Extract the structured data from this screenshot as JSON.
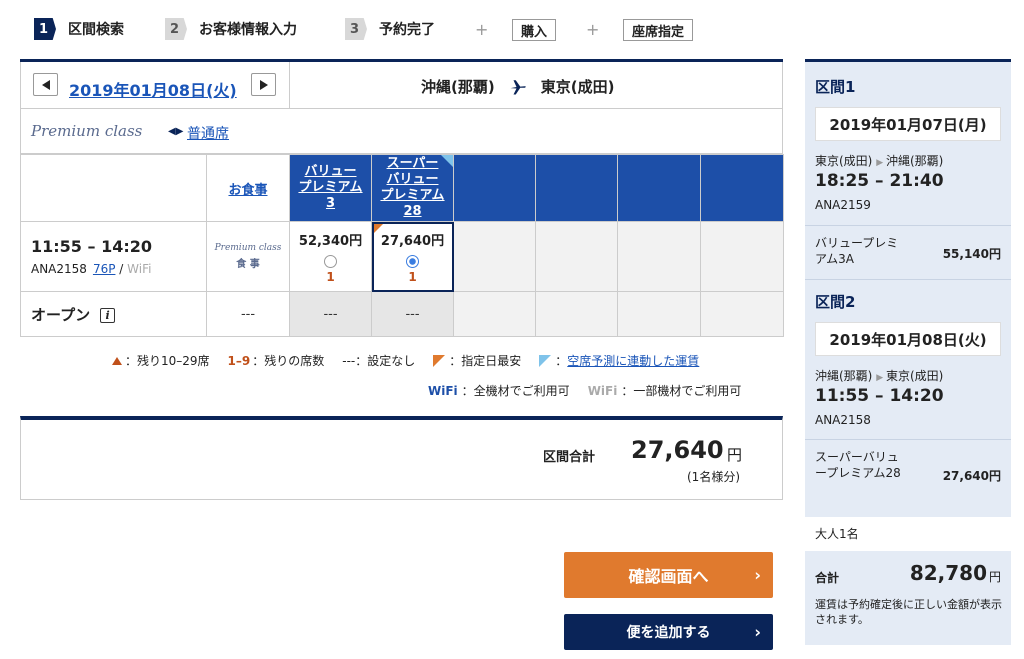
{
  "steps": {
    "items": [
      {
        "num": "1",
        "label": "区間検索"
      },
      {
        "num": "2",
        "label": "お客様情報入力"
      },
      {
        "num": "3",
        "label": "予約完了"
      }
    ],
    "plus": "+",
    "purchase": "購入",
    "seat": "座席指定"
  },
  "search": {
    "date": "2019年01月08日(火)",
    "origin": "沖縄(那覇)",
    "destination": "東京(成田)",
    "premium_class": "Premium class",
    "normal_link": "普通席"
  },
  "fares": {
    "meal_header": "お食事",
    "columns": [
      {
        "line1": "バリュー",
        "line2": "プレミアム",
        "line3": "3"
      },
      {
        "line1": "スーパー",
        "line2": "バリュー",
        "line3": "プレミアム",
        "line4": "28"
      }
    ],
    "flight": {
      "time": "11:55 – 14:20",
      "number": "ANA2158",
      "aircraft": "76P",
      "slash": "/",
      "wifi": "WiFi",
      "meal_logo": "Premium class",
      "meal_text": "食 事",
      "fare1_price": "52,340円",
      "fare1_seats": "1",
      "fare2_price": "27,640円",
      "fare2_seats": "1"
    },
    "open": {
      "label": "オープン",
      "info": "i",
      "dash": "---"
    }
  },
  "legend": {
    "remaining": "：残り10–29席",
    "num_range": "1–9",
    "num_label": "：残りの席数",
    "none": "---：設定なし",
    "cheapest": "：指定日最安",
    "linked": "空席予測に連動した運賃",
    "linked_prefix": "：",
    "wifi_all_icon": "WiFi",
    "wifi_all": "：全機材でご利用可",
    "wifi_part_icon": "WiFi",
    "wifi_part": "：一部機材でご利用可"
  },
  "total": {
    "label": "区間合計",
    "amount": "27,640",
    "yen": "円",
    "sub": "(1名様分)"
  },
  "buttons": {
    "confirm": "確認画面へ",
    "add": "便を追加する",
    "chev": "›"
  },
  "sidebar": {
    "seg1": {
      "title": "区間1",
      "date": "2019年01月07日(月)",
      "origin": "東京(成田)",
      "destination": "沖縄(那覇)",
      "time": "18:25 – 21:40",
      "flight": "ANA2159",
      "fare_name": "バリュープレミアム3A",
      "fare_price": "55,140円"
    },
    "seg2": {
      "title": "区間2",
      "date": "2019年01月08日(火)",
      "origin": "沖縄(那覇)",
      "destination": "東京(成田)",
      "time": "11:55 – 14:20",
      "flight": "ANA2158",
      "fare_name": "スーパーバリュープレミアム28",
      "fare_price": "27,640円"
    },
    "adult": "大人1名",
    "total_label": "合計",
    "total_amount": "82,780",
    "total_yen": "円",
    "note": "運賃は予約確定後に正しい金額が表示されます。"
  },
  "colors": {
    "navy": "#0a2458",
    "header_blue": "#1d4fa8",
    "orange": "#e07a2e",
    "link": "#1a55b8"
  }
}
